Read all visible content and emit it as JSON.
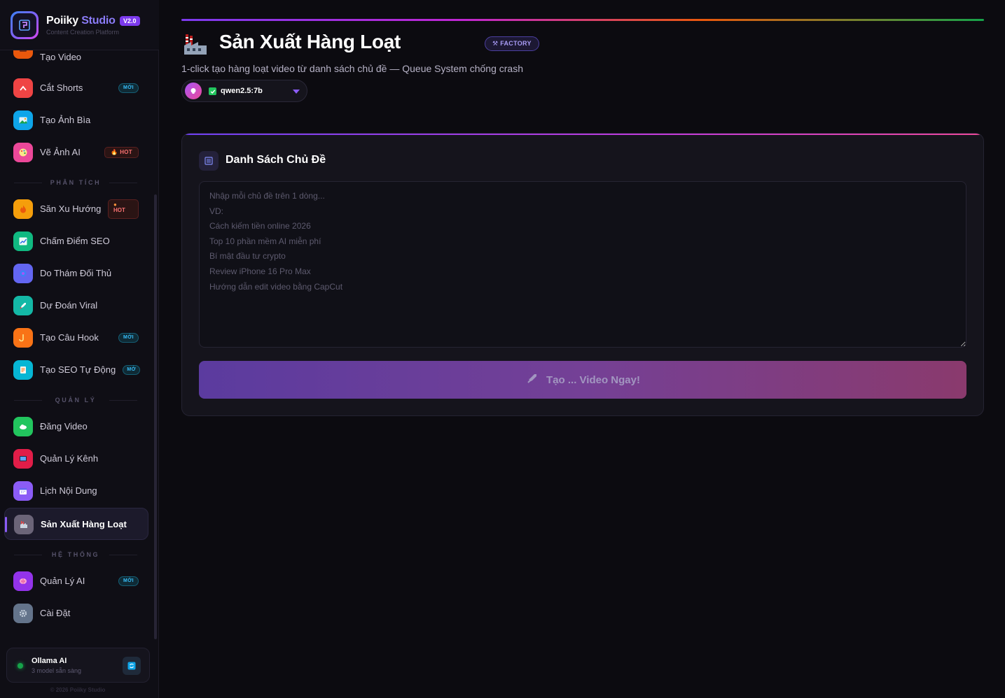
{
  "brand": {
    "name_main": "Poiiky",
    "name_accent": "Studio",
    "version": "V2.0",
    "tagline": "Content Creation Platform"
  },
  "sidebar": {
    "items_top": [
      {
        "label": "Tạo Video",
        "icon": "film-icon",
        "color": "#ea580c"
      },
      {
        "label": "Cắt Shorts",
        "icon": "scissors-icon",
        "color": "#ef4444",
        "badge": "MỚI"
      },
      {
        "label": "Tạo Ảnh Bìa",
        "icon": "image-icon",
        "color": "#0ea5e9"
      },
      {
        "label": "Vẽ Ảnh AI",
        "icon": "palette-icon",
        "color": "#ec4899",
        "badge_hot": "HOT"
      }
    ],
    "section_analysis": "PHÂN TÍCH",
    "items_analysis": [
      {
        "label": "Săn Xu Hướng",
        "icon": "fire-icon",
        "color": "#f59e0b",
        "badge_hot": "HOT"
      },
      {
        "label": "Chấm Điểm SEO",
        "icon": "chart-up-icon",
        "color": "#10b981"
      },
      {
        "label": "Do Thám Đối Thủ",
        "icon": "spy-icon",
        "color": "#6366f1"
      },
      {
        "label": "Dự Đoán Viral",
        "icon": "rocket-icon",
        "color": "#14b8a6"
      },
      {
        "label": "Tạo Câu Hook",
        "icon": "hook-icon",
        "color": "#f97316",
        "badge": "MỚI"
      },
      {
        "label": "Tạo SEO Tự Động",
        "icon": "memo-icon",
        "color": "#06b6d4",
        "badge": "MỚ"
      }
    ],
    "section_manage": "QUẢN LÝ",
    "items_manage": [
      {
        "label": "Đăng Video",
        "icon": "cloud-upload-icon",
        "color": "#22c55e"
      },
      {
        "label": "Quản Lý Kênh",
        "icon": "tv-icon",
        "color": "#e11d48"
      },
      {
        "label": "Lịch Nội Dung",
        "icon": "calendar-icon",
        "color": "#8b5cf6"
      },
      {
        "label": "Sản Xuất Hàng Loạt",
        "icon": "factory-icon",
        "color": "#6b6478",
        "active": true
      }
    ],
    "section_system": "HỆ THỐNG",
    "items_system": [
      {
        "label": "Quản Lý AI",
        "icon": "brain-icon",
        "color": "#9333ea",
        "badge": "MỚI"
      },
      {
        "label": "Cài Đặt",
        "icon": "gear-icon",
        "color": "#64748b"
      }
    ],
    "status": {
      "title": "Ollama AI",
      "subtitle": "3 model sẵn sàng"
    },
    "copyright": "© 2026 Poiiky Studio"
  },
  "main": {
    "title": "Sản Xuất Hàng Loạt",
    "badge": "FACTORY",
    "description": "1-click tạo hàng loạt video từ danh sách chủ đề — Queue System chống crash",
    "model": "qwen2.5:7b",
    "panel_title": "Danh Sách Chủ Đề",
    "textarea_placeholder": "Nhập mỗi chủ đề trên 1 dòng...\nVD:\nCách kiếm tiền online 2026\nTop 10 phần mềm AI miễn phí\nBí mật đầu tư crypto\nReview iPhone 16 Pro Max\nHướng dẫn edit video bằng CapCut",
    "run_button": "Tạo ... Video Ngay!"
  }
}
